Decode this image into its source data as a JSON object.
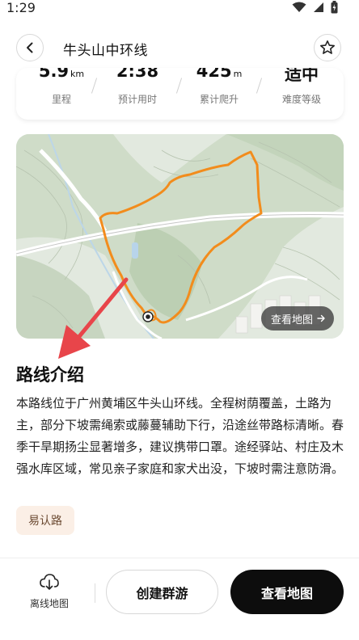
{
  "status_bar": {
    "time": "1:29"
  },
  "header": {
    "title": "牛头山中环线"
  },
  "stats": [
    {
      "value": "5.9",
      "unit": "km",
      "label": "里程"
    },
    {
      "value": "2:38",
      "unit": "",
      "label": "预计用时"
    },
    {
      "value": "425",
      "unit": "m",
      "label": "累计爬升"
    },
    {
      "value": "适中",
      "unit": "",
      "label": "难度等级"
    }
  ],
  "map": {
    "view_map_label": "查看地图",
    "route_color": "#f28c1c"
  },
  "section": {
    "title": "路线介绍",
    "description": "本路线位于广州黄埔区牛头山环线。全程树荫覆盖，土路为主，部分下坡需绳索或藤蔓辅助下行，沿途丝带路标清晰。春季干旱期扬尘显著增多，建议携带口罩。途经驿站、村庄及木强水库区域，常见亲子家庭和家犬出没，下坡时需注意防滑。"
  },
  "tags": [
    "易认路"
  ],
  "bottom_bar": {
    "offline_label": "离线地图",
    "create_group_label": "创建群游",
    "view_map_label": "查看地图"
  },
  "colors": {
    "annotation_arrow": "#e8454a",
    "primary_button": "#0d0d0d",
    "tag_bg": "#fbefe6"
  }
}
